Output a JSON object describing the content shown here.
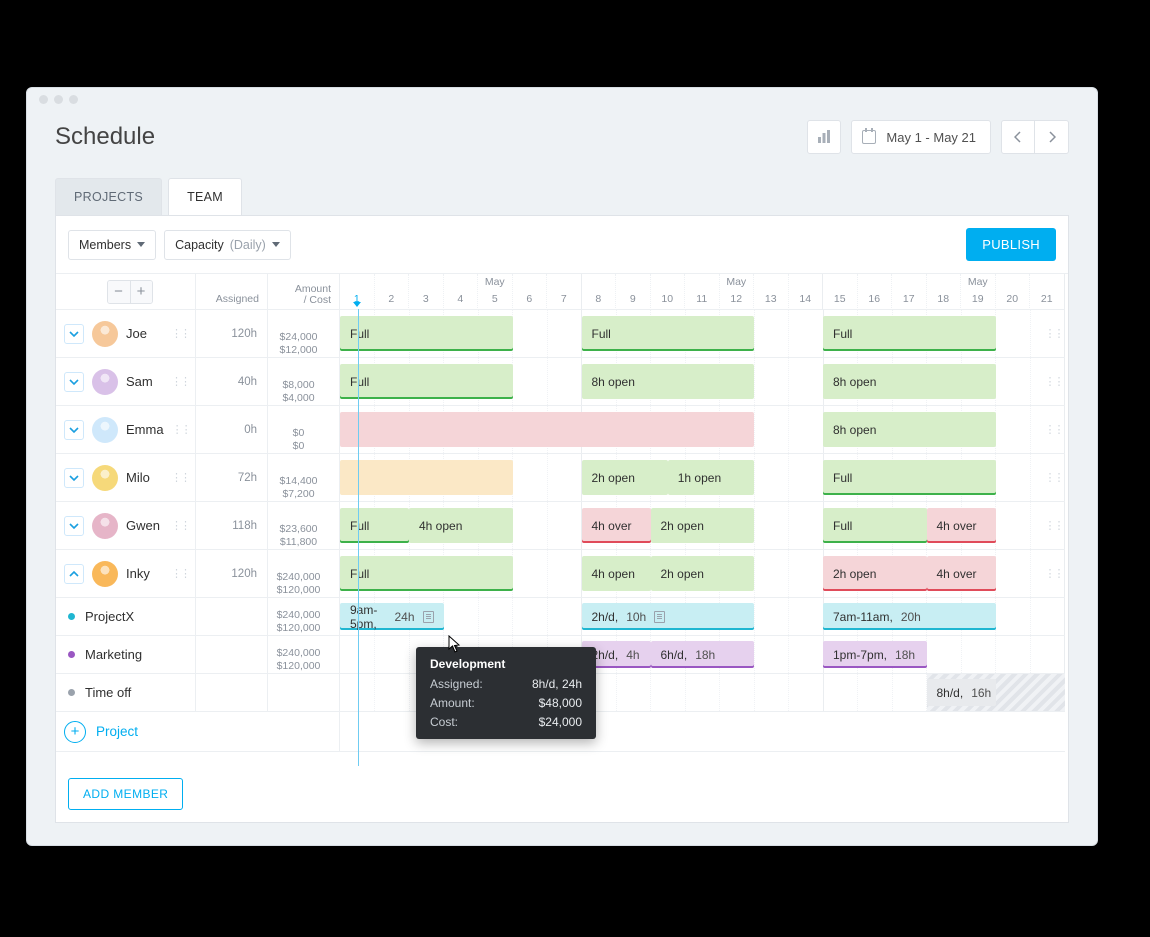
{
  "page_title": "Schedule",
  "date_range": "May 1 - May 21",
  "tabs": {
    "projects": "PROJECTS",
    "team": "TEAM"
  },
  "filters": {
    "members": "Members",
    "capacity_label": "Capacity",
    "capacity_mode": "(Daily)"
  },
  "publish": "PUBLISH",
  "headers": {
    "assigned": "Assigned",
    "amount_line1": "Amount",
    "amount_line2": "/ Cost",
    "month": "May"
  },
  "days": [
    "1",
    "2",
    "3",
    "4",
    "5",
    "6",
    "7",
    "8",
    "9",
    "10",
    "11",
    "12",
    "13",
    "14",
    "15",
    "16",
    "17",
    "18",
    "19",
    "20",
    "21"
  ],
  "members": [
    {
      "name": "Joe",
      "assigned": "120h",
      "amount": "$24,000",
      "cost": "$12,000",
      "avatar_bg": "#f6c89a"
    },
    {
      "name": "Sam",
      "assigned": "40h",
      "amount": "$8,000",
      "cost": "$4,000",
      "avatar_bg": "#d9c1e8"
    },
    {
      "name": "Emma",
      "assigned": "0h",
      "amount": "$0",
      "cost": "$0",
      "avatar_bg": "#cfe8fb"
    },
    {
      "name": "Milo",
      "assigned": "72h",
      "amount": "$14,400",
      "cost": "$7,200",
      "avatar_bg": "#f6d97a"
    },
    {
      "name": "Gwen",
      "assigned": "118h",
      "amount": "$23,600",
      "cost": "$11,800",
      "avatar_bg": "#e6b5c8"
    },
    {
      "name": "Inky",
      "assigned": "120h",
      "amount": "$240,000",
      "cost": "$120,000",
      "avatar_bg": "#f9b85a"
    }
  ],
  "labels": {
    "full": "Full",
    "8h_open": "8h open",
    "2h_open": "2h open",
    "1h_open": "1h open",
    "4h_open": "4h open",
    "4h_over": "4h over"
  },
  "inky_sub": {
    "projectx": {
      "name": "ProjectX",
      "amount": "$240,000",
      "cost": "$120,000",
      "b1_time": "9am-5pm,",
      "b1_h": "24h",
      "b2_prefix": "2h/d,",
      "b2_h": "10h",
      "b3_time": "7am-11am,",
      "b3_h": "20h"
    },
    "marketing": {
      "name": "Marketing",
      "amount": "$240,000",
      "cost": "$120,000",
      "b1_prefix": "2h/d,",
      "b1_h": "4h",
      "b2_prefix": "6h/d,",
      "b2_h": "18h",
      "b3_time": "1pm-7pm,",
      "b3_h": "18h"
    },
    "timeoff": {
      "name": "Time off",
      "b1_prefix": "8h/d,",
      "b1_h": "16h"
    }
  },
  "add_project": "Project",
  "add_member": "ADD MEMBER",
  "tooltip": {
    "title": "Development",
    "row1_k": "Assigned:",
    "row1_v": "8h/d, 24h",
    "row2_k": "Amount:",
    "row2_v": "$48,000",
    "row3_k": "Cost:",
    "row3_v": "$24,000"
  }
}
